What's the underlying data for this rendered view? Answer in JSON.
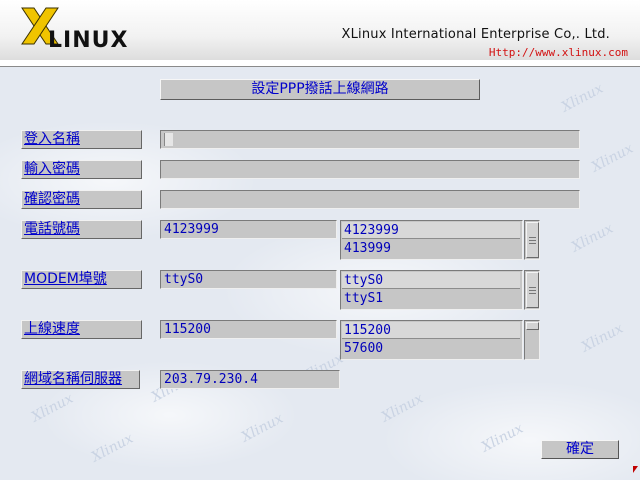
{
  "header": {
    "logo_text": "LINUX",
    "company": "XLinux International Enterprise Co,. Ltd.",
    "url": "Http://www.xlinux.com"
  },
  "form": {
    "title": "設定PPP撥話上線網路",
    "login_label": "登入名稱",
    "password_label": "輸入密碼",
    "confirm_label": "確認密碼",
    "phone_label": "電話號碼",
    "phone_value": "4123999",
    "phone_options": [
      "4123999",
      "413999"
    ],
    "modem_label": "MODEM埠號",
    "modem_value": "ttyS0",
    "modem_options": [
      "ttyS0",
      "ttyS1"
    ],
    "speed_label": "上線速度",
    "speed_value": "115200",
    "speed_options": [
      "115200",
      "57600"
    ],
    "dns_label": "網域名稱伺服器",
    "dns_value": "203.79.230.4",
    "ok_label": "確定"
  },
  "colors": {
    "label_text": "#0000cc",
    "url": "#d21010",
    "panel": "#c6c6c6"
  }
}
